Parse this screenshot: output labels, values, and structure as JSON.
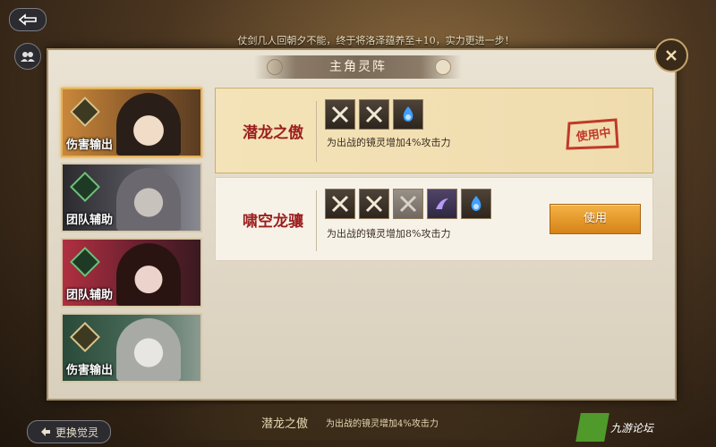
{
  "top_bar": {
    "notice": "仗剑几人回朝夕不能，终于将洛泽蕴养至+10，实力更进一步！"
  },
  "modal": {
    "title": "主角灵阵"
  },
  "characters": [
    {
      "role": "伤害输出",
      "selected": true
    },
    {
      "role": "团队辅助",
      "selected": false
    },
    {
      "role": "团队辅助",
      "selected": false
    },
    {
      "role": "伤害输出",
      "selected": false
    }
  ],
  "formations": [
    {
      "name": "潜龙之傲",
      "description": "为出战的镜灵增加4%攻击力",
      "skills": [
        "crossed-swords-icon",
        "crossed-swords-icon",
        "blue-flame-icon"
      ],
      "status": "使用中"
    },
    {
      "name": "啸空龙骧",
      "description": "为出战的镜灵增加8%攻击力",
      "skills": [
        "crossed-swords-icon",
        "crossed-swords-icon",
        "crossed-swords-icon",
        "purple-claw-icon",
        "blue-flame-icon"
      ],
      "action": "使用"
    }
  ],
  "bottom": {
    "swap_label": "更换觉灵",
    "current_name": "潜龙之傲",
    "current_desc": "为出战的镜灵增加4%攻击力",
    "watermark": "九游论坛"
  },
  "colors": {
    "accent_gold": "#e4b25a",
    "formation_name": "#9b1e1e",
    "use_button": "#e99a2c"
  }
}
